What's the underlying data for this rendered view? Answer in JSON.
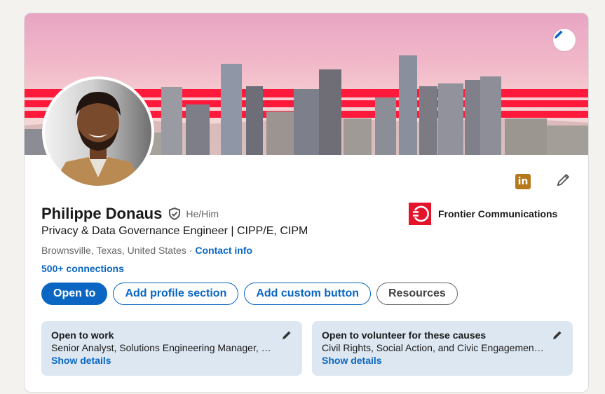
{
  "profile": {
    "name": "Philippe Donaus",
    "pronouns": "He/Him",
    "headline": "Privacy & Data Governance Engineer | CIPP/E, CIPM",
    "location": "Brownsville, Texas, United States",
    "separator": "·",
    "contact_info_label": "Contact info",
    "connections_label": "500+ connections"
  },
  "company": {
    "name": "Frontier Communications",
    "logo_color": "#e4142b"
  },
  "actions": {
    "open_to": "Open to",
    "add_profile_section": "Add profile section",
    "add_custom_button": "Add custom button",
    "resources": "Resources"
  },
  "promos": [
    {
      "title": "Open to work",
      "description": "Senior Analyst, Solutions Engineering Manager, …",
      "link": "Show details"
    },
    {
      "title": "Open to volunteer for these causes",
      "description": "Civil Rights, Social Action, and Civic Engagemen…",
      "link": "Show details"
    }
  ],
  "icons": {
    "linkedin": "in",
    "edit": "pencil-icon",
    "verified": "shield-icon"
  },
  "colors": {
    "primary": "#0a66c2",
    "banner_stripe": "#ff1a3c",
    "promo_bg": "#dde7f1"
  }
}
